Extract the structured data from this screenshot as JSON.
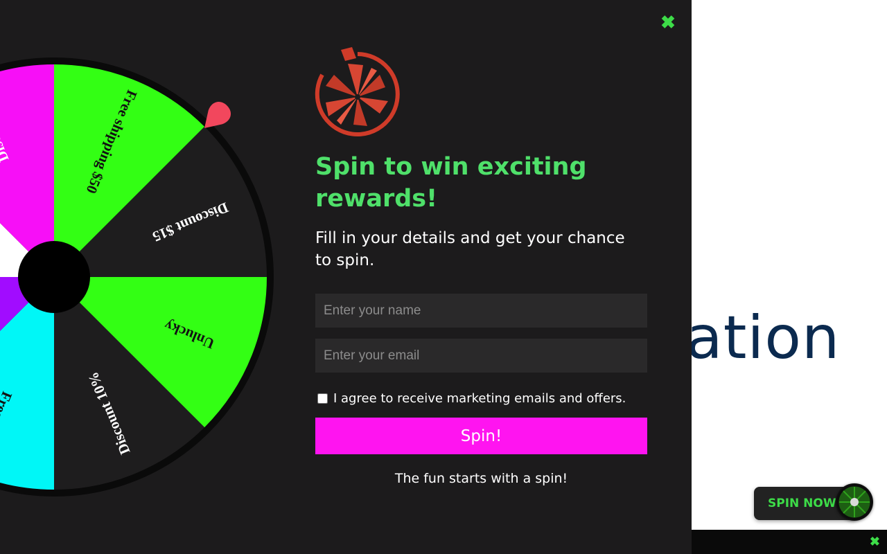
{
  "background": {
    "heading_fragment": "ation",
    "bar_close_icon": "close-icon",
    "spin_now_label": "SPIN NOW"
  },
  "popup": {
    "close_icon": "close-icon",
    "title": "Spin to win exciting rewards!",
    "subtitle": "Fill in your details and get your chance to spin.",
    "name_placeholder": "Enter your name",
    "email_placeholder": "Enter your email",
    "consent_label": "I agree to receive marketing emails and offers.",
    "consent_checked": false,
    "spin_button_label": "Spin!",
    "footer_text": "The fun starts with a spin!",
    "logo_icon": "spin-wheel-logo-icon"
  },
  "wheel": {
    "segments": [
      {
        "label": "Free shipping $50",
        "color": "#33ff14",
        "text_color": "#111111"
      },
      {
        "label": "Discount $15",
        "color": "#1e1d1e",
        "text_color": "#ffffff"
      },
      {
        "label": "Unlucky",
        "color": "#33ff14",
        "text_color": "#111111"
      },
      {
        "label": "Discount 10%",
        "color": "#1e1d1e",
        "text_color": "#ffffff"
      },
      {
        "label": "Free sh",
        "color": "#00f7f7",
        "text_color": "#111111"
      },
      {
        "label": "",
        "color": "#a10cff",
        "text_color": "#ffffff"
      },
      {
        "label": "",
        "color": "#ffffff",
        "text_color": "#111111"
      },
      {
        "label": "Discou",
        "color": "#f70ff7",
        "text_color": "#ffffff"
      }
    ],
    "pointer_color": "#f2475d",
    "hub_color": "#000000",
    "rim_color": "#0a0a0a"
  },
  "colors": {
    "accent_green": "#4fe06a",
    "accent_magenta": "#ff14f0",
    "popup_bg": "#1c1b1c"
  }
}
